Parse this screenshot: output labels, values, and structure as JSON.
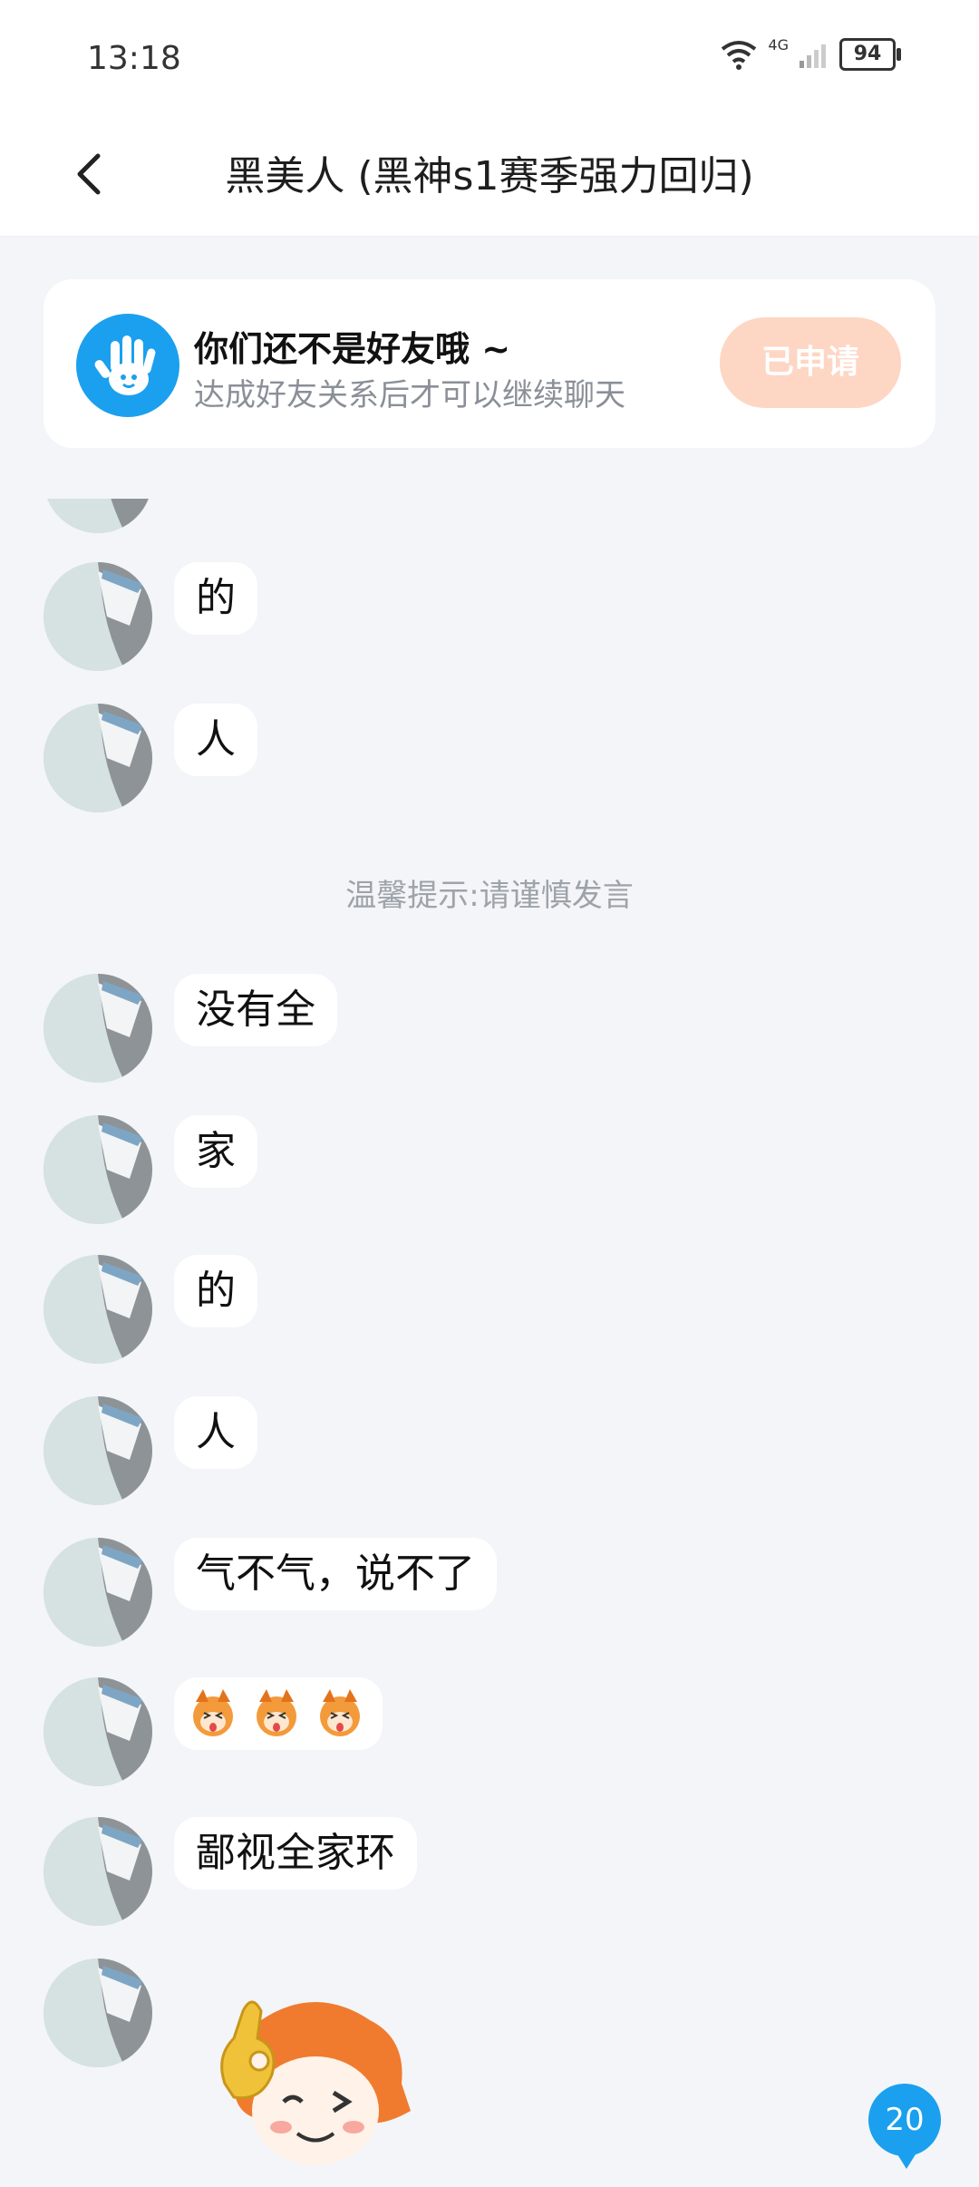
{
  "status": {
    "time": "13:18",
    "battery": "94",
    "network": "4G"
  },
  "header": {
    "title": "黑美人 (黑神s1赛季强力回归)"
  },
  "friend_card": {
    "title": "你们还不是好友哦 ~",
    "subtitle": "达成好友关系后才可以继续聊天",
    "button_label": "已申请"
  },
  "hint": "温馨提示:请谨慎发言",
  "messages": [
    {
      "text": "的"
    },
    {
      "text": "人"
    },
    {
      "text": "没有全"
    },
    {
      "text": "家"
    },
    {
      "text": "的"
    },
    {
      "text": "人"
    },
    {
      "text": "气不气，说不了"
    },
    {
      "text": "emoji-stickers"
    },
    {
      "text": "鄙视全家环"
    },
    {
      "text": "sticker"
    }
  ],
  "unread_count": "20",
  "colors": {
    "accent": "#1aa0ee",
    "applied_bg": "#fdd6c4",
    "page_bg": "#f3f5f8"
  }
}
